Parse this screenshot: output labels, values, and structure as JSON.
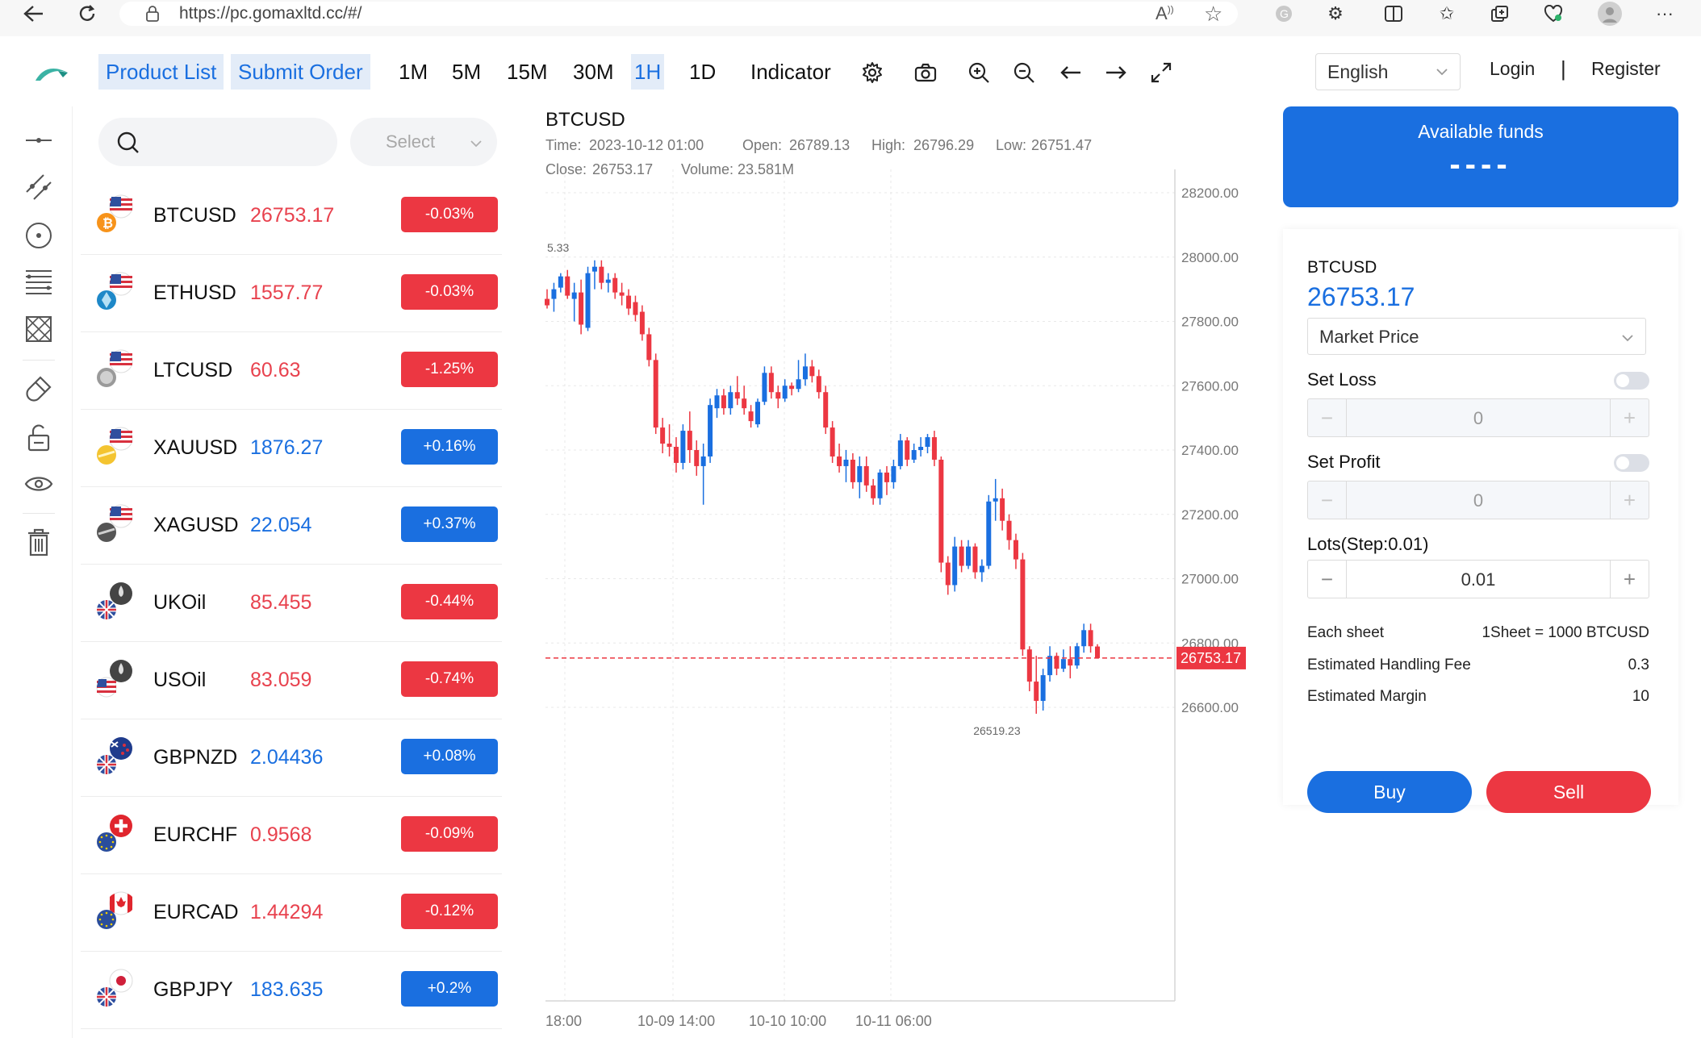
{
  "browser": {
    "url": "https://pc.gomaxltd.cc/#/"
  },
  "header": {
    "product_list": "Product List",
    "submit_order": "Submit Order",
    "periods": [
      "1M",
      "5M",
      "15M",
      "30M",
      "1H",
      "1D"
    ],
    "active_period": "1H",
    "indicator": "Indicator",
    "language": "English",
    "login": "Login",
    "separator": "|",
    "register": "Register"
  },
  "products": {
    "search_placeholder": "",
    "select_placeholder": "Select",
    "items": [
      {
        "symbol": "BTCUSD",
        "price": "26753.17",
        "change": "-0.03%",
        "dir": "down"
      },
      {
        "symbol": "ETHUSD",
        "price": "1557.77",
        "change": "-0.03%",
        "dir": "down"
      },
      {
        "symbol": "LTCUSD",
        "price": "60.63",
        "change": "-1.25%",
        "dir": "down"
      },
      {
        "symbol": "XAUUSD",
        "price": "1876.27",
        "change": "+0.16%",
        "dir": "up"
      },
      {
        "symbol": "XAGUSD",
        "price": "22.054",
        "change": "+0.37%",
        "dir": "up"
      },
      {
        "symbol": "UKOil",
        "price": "85.455",
        "change": "-0.44%",
        "dir": "down"
      },
      {
        "symbol": "USOil",
        "price": "83.059",
        "change": "-0.74%",
        "dir": "down"
      },
      {
        "symbol": "GBPNZD",
        "price": "2.04436",
        "change": "+0.08%",
        "dir": "up"
      },
      {
        "symbol": "EURCHF",
        "price": "0.9568",
        "change": "-0.09%",
        "dir": "down"
      },
      {
        "symbol": "EURCAD",
        "price": "1.44294",
        "change": "-0.12%",
        "dir": "down"
      },
      {
        "symbol": "GBPJPY",
        "price": "183.635",
        "change": "+0.2%",
        "dir": "up"
      }
    ]
  },
  "chart": {
    "symbol": "BTCUSD",
    "time_label": "Time:",
    "time": "2023-10-12 01:00",
    "open_label": "Open:",
    "open": "26789.13",
    "high_label": "High:",
    "high": "26796.29",
    "low_label": "Low:",
    "low": "26751.47",
    "close_label": "Close:",
    "close": "26753.17",
    "volume_label": "Volume:",
    "volume": "23.581M",
    "y_ticks": [
      "28200.00",
      "28000.00",
      "27800.00",
      "27600.00",
      "27400.00",
      "27200.00",
      "27000.00",
      "26800.00",
      "26600.00"
    ],
    "y_tick_values": [
      28200,
      28000,
      27800,
      27600,
      27400,
      27200,
      27000,
      26800,
      26600
    ],
    "x_ticks": [
      "18:00",
      "10-09 14:00",
      "10-10 10:00",
      "10-11 06:00"
    ],
    "last_price": "26753.17",
    "last_price_value": 26753.17,
    "min_label": "26519.23",
    "max_label_fragment": "5.33",
    "colors": {
      "up": "#1a6fe0",
      "down": "#ec3742",
      "grid": "#e8e8e8"
    }
  },
  "chart_data": {
    "type": "candlestick",
    "title": "BTCUSD",
    "x_tick_labels": [
      "18:00",
      "10-09 14:00",
      "10-10 10:00",
      "10-11 06:00"
    ],
    "ylim": [
      26440,
      28310
    ],
    "grid": true,
    "candles": [
      {
        "o": 27870,
        "h": 27900,
        "l": 27840,
        "c": 27850
      },
      {
        "o": 27870,
        "h": 27920,
        "l": 27830,
        "c": 27900
      },
      {
        "o": 27905,
        "h": 27950,
        "l": 27890,
        "c": 27940
      },
      {
        "o": 27940,
        "h": 27960,
        "l": 27870,
        "c": 27880
      },
      {
        "o": 27870,
        "h": 27920,
        "l": 27800,
        "c": 27890
      },
      {
        "o": 27890,
        "h": 27930,
        "l": 27760,
        "c": 27790
      },
      {
        "o": 27780,
        "h": 27970,
        "l": 27770,
        "c": 27950
      },
      {
        "o": 27955,
        "h": 27990,
        "l": 27900,
        "c": 27970
      },
      {
        "o": 27970,
        "h": 27990,
        "l": 27900,
        "c": 27920
      },
      {
        "o": 27920,
        "h": 27950,
        "l": 27890,
        "c": 27930
      },
      {
        "o": 27935,
        "h": 27950,
        "l": 27870,
        "c": 27890
      },
      {
        "o": 27890,
        "h": 27920,
        "l": 27850,
        "c": 27880
      },
      {
        "o": 27880,
        "h": 27900,
        "l": 27820,
        "c": 27840
      },
      {
        "o": 27860,
        "h": 27880,
        "l": 27800,
        "c": 27820
      },
      {
        "o": 27830,
        "h": 27850,
        "l": 27740,
        "c": 27760
      },
      {
        "o": 27760,
        "h": 27780,
        "l": 27660,
        "c": 27680
      },
      {
        "o": 27680,
        "h": 27700,
        "l": 27450,
        "c": 27470
      },
      {
        "o": 27470,
        "h": 27500,
        "l": 27390,
        "c": 27420
      },
      {
        "o": 27420,
        "h": 27480,
        "l": 27380,
        "c": 27410
      },
      {
        "o": 27410,
        "h": 27440,
        "l": 27330,
        "c": 27360
      },
      {
        "o": 27360,
        "h": 27480,
        "l": 27340,
        "c": 27460
      },
      {
        "o": 27460,
        "h": 27520,
        "l": 27360,
        "c": 27400
      },
      {
        "o": 27400,
        "h": 27430,
        "l": 27320,
        "c": 27350
      },
      {
        "o": 27350,
        "h": 27420,
        "l": 27230,
        "c": 27380
      },
      {
        "o": 27380,
        "h": 27560,
        "l": 27360,
        "c": 27540
      },
      {
        "o": 27530,
        "h": 27590,
        "l": 27500,
        "c": 27570
      },
      {
        "o": 27570,
        "h": 27590,
        "l": 27510,
        "c": 27530
      },
      {
        "o": 27530,
        "h": 27600,
        "l": 27510,
        "c": 27580
      },
      {
        "o": 27580,
        "h": 27630,
        "l": 27540,
        "c": 27560
      },
      {
        "o": 27560,
        "h": 27600,
        "l": 27510,
        "c": 27530
      },
      {
        "o": 27520,
        "h": 27540,
        "l": 27470,
        "c": 27490
      },
      {
        "o": 27480,
        "h": 27560,
        "l": 27470,
        "c": 27550
      },
      {
        "o": 27550,
        "h": 27660,
        "l": 27540,
        "c": 27640
      },
      {
        "o": 27640,
        "h": 27660,
        "l": 27560,
        "c": 27580
      },
      {
        "o": 27580,
        "h": 27600,
        "l": 27530,
        "c": 27560
      },
      {
        "o": 27560,
        "h": 27620,
        "l": 27550,
        "c": 27600
      },
      {
        "o": 27600,
        "h": 27610,
        "l": 27570,
        "c": 27590
      },
      {
        "o": 27590,
        "h": 27680,
        "l": 27580,
        "c": 27620
      },
      {
        "o": 27620,
        "h": 27700,
        "l": 27600,
        "c": 27660
      },
      {
        "o": 27660,
        "h": 27680,
        "l": 27610,
        "c": 27630
      },
      {
        "o": 27630,
        "h": 27650,
        "l": 27560,
        "c": 27580
      },
      {
        "o": 27580,
        "h": 27600,
        "l": 27450,
        "c": 27470
      },
      {
        "o": 27470,
        "h": 27490,
        "l": 27360,
        "c": 27380
      },
      {
        "o": 27380,
        "h": 27420,
        "l": 27330,
        "c": 27350
      },
      {
        "o": 27350,
        "h": 27400,
        "l": 27300,
        "c": 27370
      },
      {
        "o": 27370,
        "h": 27390,
        "l": 27280,
        "c": 27300
      },
      {
        "o": 27300,
        "h": 27380,
        "l": 27250,
        "c": 27350
      },
      {
        "o": 27350,
        "h": 27380,
        "l": 27270,
        "c": 27290
      },
      {
        "o": 27290,
        "h": 27310,
        "l": 27230,
        "c": 27250
      },
      {
        "o": 27250,
        "h": 27340,
        "l": 27230,
        "c": 27330
      },
      {
        "o": 27330,
        "h": 27350,
        "l": 27260,
        "c": 27300
      },
      {
        "o": 27300,
        "h": 27370,
        "l": 27280,
        "c": 27350
      },
      {
        "o": 27350,
        "h": 27450,
        "l": 27340,
        "c": 27430
      },
      {
        "o": 27430,
        "h": 27440,
        "l": 27350,
        "c": 27370
      },
      {
        "o": 27370,
        "h": 27420,
        "l": 27360,
        "c": 27400
      },
      {
        "o": 27400,
        "h": 27440,
        "l": 27380,
        "c": 27410
      },
      {
        "o": 27410,
        "h": 27450,
        "l": 27390,
        "c": 27440
      },
      {
        "o": 27440,
        "h": 27460,
        "l": 27350,
        "c": 27370
      },
      {
        "o": 27370,
        "h": 27380,
        "l": 27020,
        "c": 27050
      },
      {
        "o": 27050,
        "h": 27070,
        "l": 26950,
        "c": 26980
      },
      {
        "o": 26980,
        "h": 27130,
        "l": 26960,
        "c": 27100
      },
      {
        "o": 27100,
        "h": 27120,
        "l": 27020,
        "c": 27040
      },
      {
        "o": 27040,
        "h": 27120,
        "l": 27030,
        "c": 27100
      },
      {
        "o": 27100,
        "h": 27110,
        "l": 27000,
        "c": 27020
      },
      {
        "o": 27020,
        "h": 27060,
        "l": 26990,
        "c": 27040
      },
      {
        "o": 27040,
        "h": 27260,
        "l": 27030,
        "c": 27240
      },
      {
        "o": 27240,
        "h": 27310,
        "l": 27180,
        "c": 27250
      },
      {
        "o": 27250,
        "h": 27280,
        "l": 27150,
        "c": 27180
      },
      {
        "o": 27180,
        "h": 27200,
        "l": 27090,
        "c": 27120
      },
      {
        "o": 27120,
        "h": 27140,
        "l": 27030,
        "c": 27060
      },
      {
        "o": 27060,
        "h": 27080,
        "l": 26760,
        "c": 26780
      },
      {
        "o": 26780,
        "h": 26790,
        "l": 26650,
        "c": 26680
      },
      {
        "o": 26680,
        "h": 26760,
        "l": 26580,
        "c": 26620
      },
      {
        "o": 26620,
        "h": 26720,
        "l": 26590,
        "c": 26700
      },
      {
        "o": 26700,
        "h": 26790,
        "l": 26680,
        "c": 26760
      },
      {
        "o": 26760,
        "h": 26770,
        "l": 26700,
        "c": 26720
      },
      {
        "o": 26720,
        "h": 26780,
        "l": 26710,
        "c": 26750
      },
      {
        "o": 26750,
        "h": 26790,
        "l": 26690,
        "c": 26730
      },
      {
        "o": 26730,
        "h": 26800,
        "l": 26720,
        "c": 26790
      },
      {
        "o": 26790,
        "h": 26860,
        "l": 26770,
        "c": 26840
      },
      {
        "o": 26840,
        "h": 26860,
        "l": 26770,
        "c": 26790
      },
      {
        "o": 26789.13,
        "h": 26796.29,
        "l": 26751.47,
        "c": 26753.17
      }
    ]
  },
  "funds": {
    "label": "Available funds",
    "value": "----"
  },
  "order": {
    "symbol": "BTCUSD",
    "price": "26753.17",
    "price_type": "Market Price",
    "set_loss_label": "Set Loss",
    "set_loss_value": "0",
    "set_profit_label": "Set Profit",
    "set_profit_value": "0",
    "lots_label": "Lots(Step:0.01)",
    "lots_value": "0.01",
    "each_sheet_label": "Each sheet",
    "each_sheet_value": "1Sheet = 1000 BTCUSD",
    "fee_label": "Estimated Handling Fee",
    "fee_value": "0.3",
    "margin_label": "Estimated Margin",
    "margin_value": "10",
    "buy": "Buy",
    "sell": "Sell",
    "minus": "−",
    "plus": "+"
  }
}
